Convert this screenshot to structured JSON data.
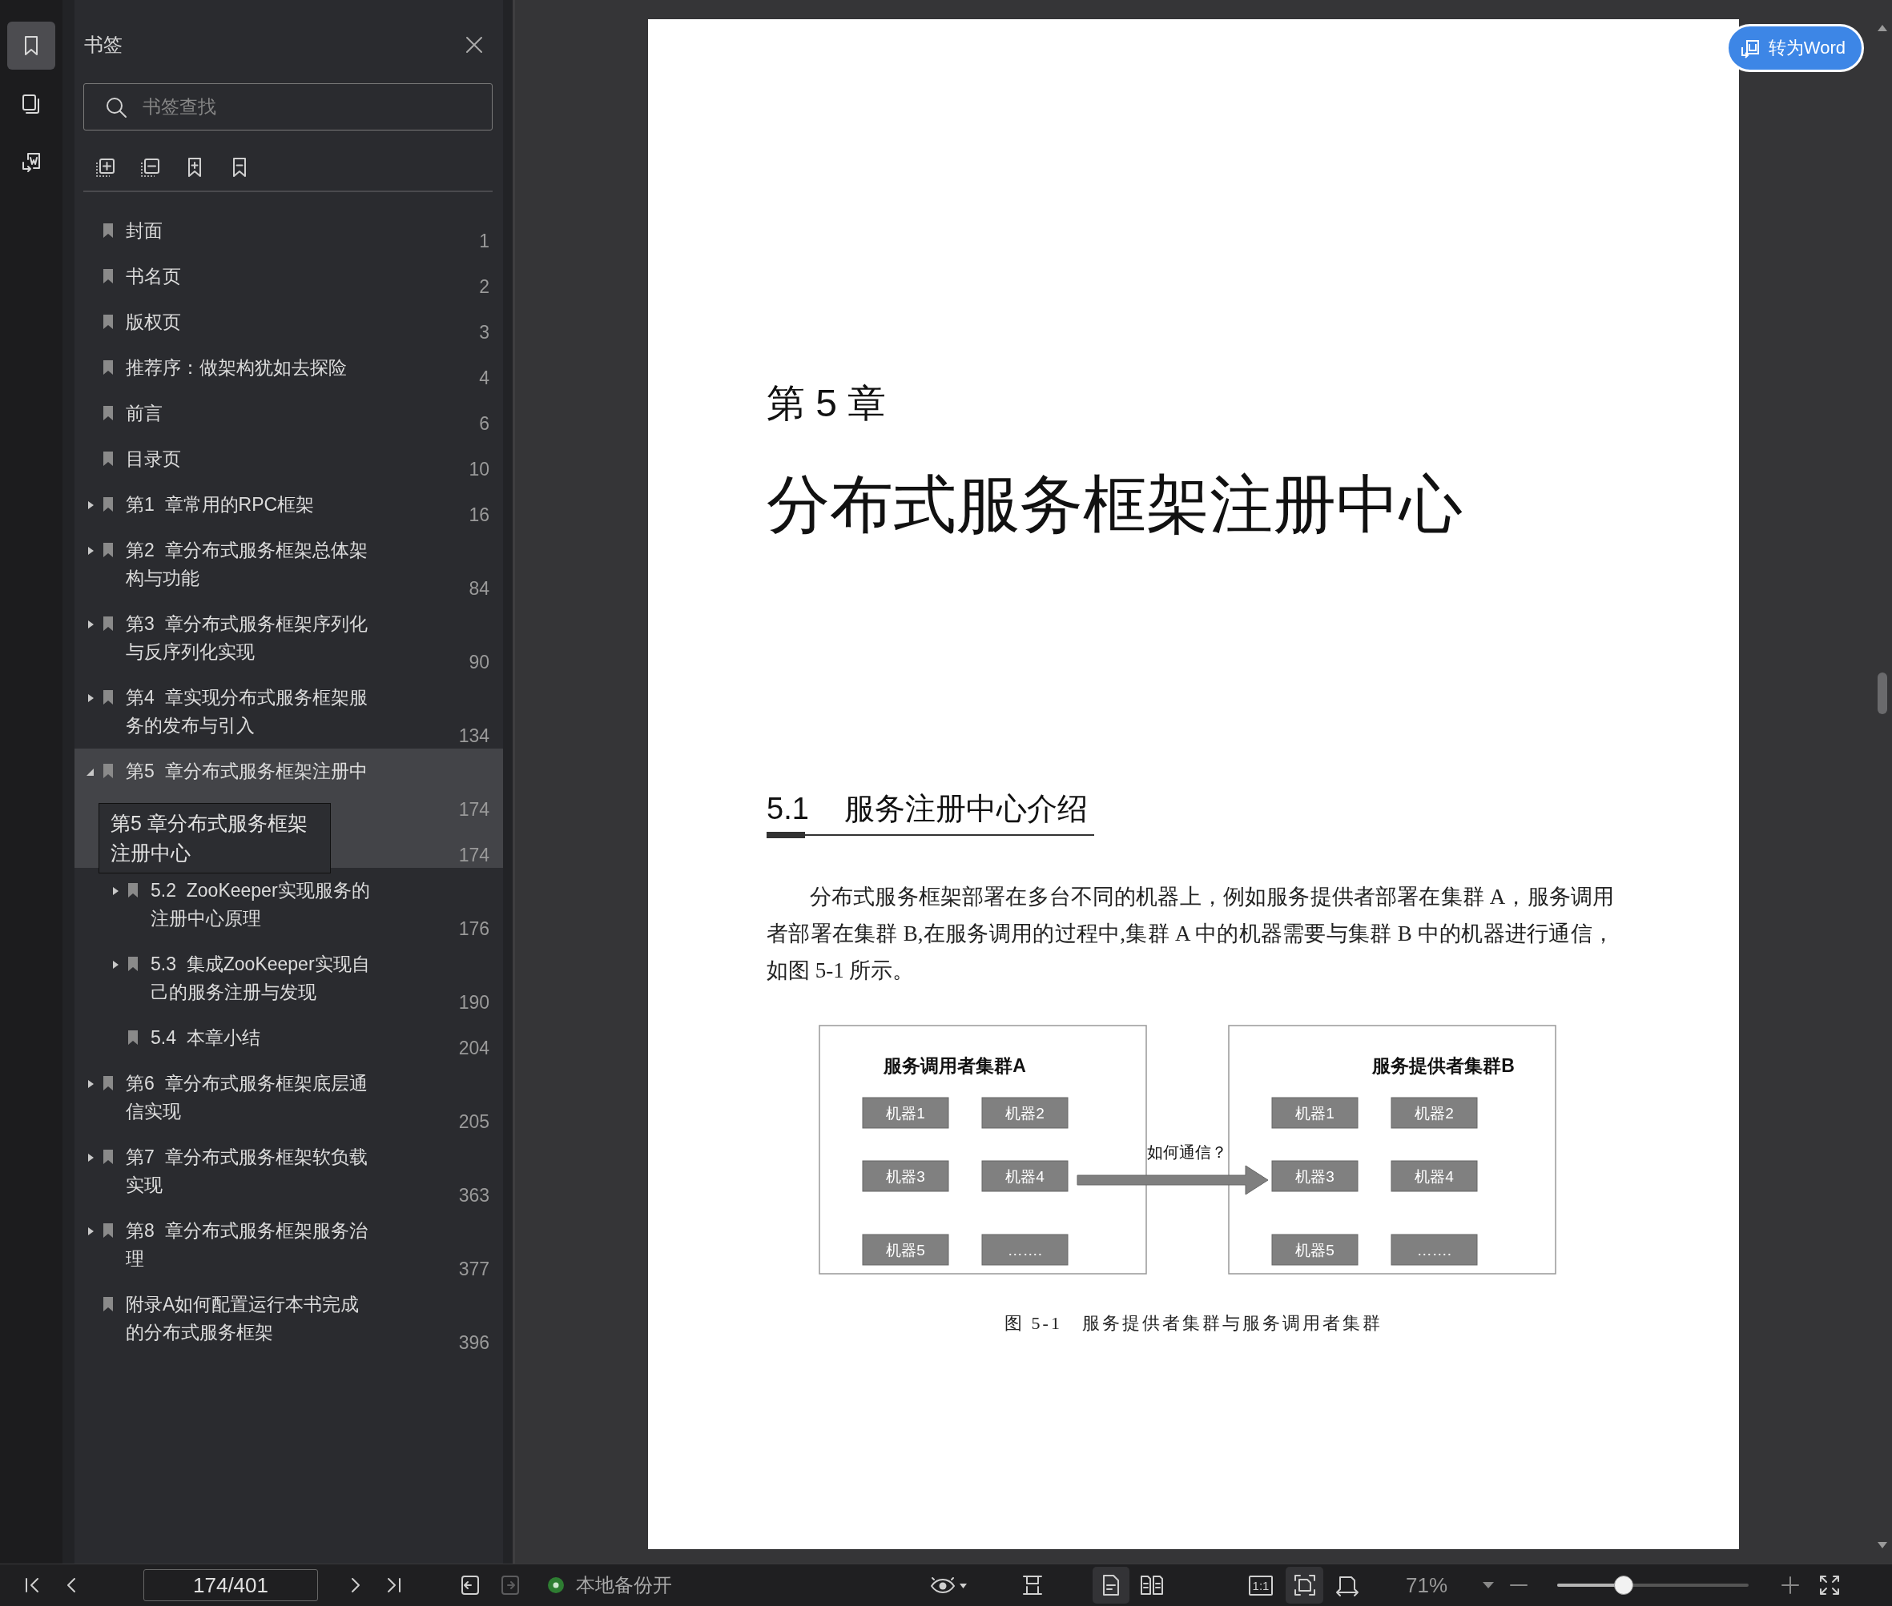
{
  "rail_tabs": [
    {
      "kind": "bookmarks",
      "selected": true
    },
    {
      "kind": "thumbnails",
      "selected": false
    },
    {
      "kind": "to-word",
      "selected": false
    }
  ],
  "sidebar": {
    "title": "书签",
    "search": {
      "placeholder": "书签查找"
    },
    "bookmarks": [
      {
        "kind": "leaf",
        "label": "封面",
        "page": "1",
        "selected": false
      },
      {
        "kind": "leaf",
        "label": "书名页",
        "page": "2",
        "selected": false
      },
      {
        "kind": "leaf",
        "label": "版权页",
        "page": "3",
        "selected": false
      },
      {
        "kind": "leaf",
        "label": "推荐序：做架构犹如去探险",
        "page": "4",
        "selected": false
      },
      {
        "kind": "leaf",
        "label": "前言",
        "page": "6",
        "selected": false
      },
      {
        "kind": "leaf",
        "label": "目录页",
        "page": "10",
        "selected": false
      },
      {
        "kind": "branch",
        "label": "第1  章常用的RPC框架",
        "page": "16",
        "selected": false,
        "expanded": false
      },
      {
        "kind": "branch",
        "label": "第2  章分布式服务框架总体架构与功能",
        "page": "84",
        "selected": false,
        "expanded": false
      },
      {
        "kind": "branch",
        "label": "第3  章分布式服务框架序列化与反序列化实现",
        "page": "90",
        "selected": false,
        "expanded": false
      },
      {
        "kind": "branch",
        "label": "第4  章实现分布式服务框架服务的发布与引入",
        "page": "134",
        "selected": false,
        "expanded": false
      },
      {
        "kind": "branch",
        "label": "第5  章分布式服务框架注册中",
        "page": "174",
        "selected": true,
        "expanded": true,
        "tooltip": "第5 章分布式服务框架注册中心",
        "children": [
          {
            "kind": "leaf",
            "page": "174",
            "selected": true
          },
          {
            "kind": "branch",
            "label": "5.2  ZooKeeper实现服务的注册中心原理",
            "page": "176",
            "selected": false,
            "expanded": false
          },
          {
            "kind": "branch",
            "label": "5.3  集成ZooKeeper实现自己的服务注册与发现",
            "page": "190",
            "selected": false,
            "expanded": false
          },
          {
            "kind": "leaf",
            "label": "5.4  本章小结",
            "page": "204",
            "selected": false
          }
        ]
      },
      {
        "kind": "branch",
        "label": "第6  章分布式服务框架底层通信实现",
        "page": "205",
        "selected": false,
        "expanded": false
      },
      {
        "kind": "branch",
        "label": "第7  章分布式服务框架软负载实现",
        "page": "363",
        "selected": false,
        "expanded": false
      },
      {
        "kind": "branch",
        "label": "第8  章分布式服务框架服务治理",
        "page": "377",
        "selected": false,
        "expanded": false
      },
      {
        "kind": "leaf",
        "label": "附录A如何配置运行本书完成的分布式服务框架",
        "page": "396",
        "selected": false
      }
    ]
  },
  "document": {
    "chapter_label": "第 5 章",
    "chapter_title": "分布式服务框架注册中心",
    "section": {
      "number": "5.1",
      "title": "服务注册中心介绍"
    },
    "paragraph": "分布式服务框架部署在多台不同的机器上，例如服务提供者部署在集群 A，服务调用者部署在集群 B,在服务调用的过程中,集群 A 中的机器需要与集群 B 中的机器进行通信，如图 5-1 所示。",
    "figure": {
      "clusters": [
        {
          "title": "服务调用者集群A",
          "machines": [
            "机器1",
            "机器2",
            "机器3",
            "机器4",
            "机器5",
            "……."
          ]
        },
        {
          "title": "服务提供者集群B",
          "machines": [
            "机器1",
            "机器2",
            "机器3",
            "机器4",
            "机器5",
            "……."
          ]
        }
      ],
      "arrow_label": "如何通信？",
      "caption": "图 5-1　服务提供者集群与服务调用者集群"
    }
  },
  "convert_button": {
    "label": "转为Word"
  },
  "status_bar": {
    "page_field": "174/401",
    "doc_nav": [
      {
        "kind": "back",
        "disabled": false
      },
      {
        "kind": "forward",
        "disabled": true
      }
    ],
    "backup": {
      "label": "本地备份开",
      "on": true
    },
    "view_tools": [
      {
        "kind": "eye-menu",
        "selected": false
      },
      {
        "kind": "fit-width",
        "selected": false
      },
      {
        "kind": "single-page",
        "selected": true
      },
      {
        "kind": "two-page",
        "selected": false
      },
      {
        "kind": "actual-size",
        "label": "1:1",
        "selected": false
      },
      {
        "kind": "fit-page",
        "selected": true
      },
      {
        "kind": "fit-width-arrow",
        "selected": false
      }
    ],
    "zoom": "71%",
    "zoom_slider": {
      "level": 0.36
    }
  }
}
